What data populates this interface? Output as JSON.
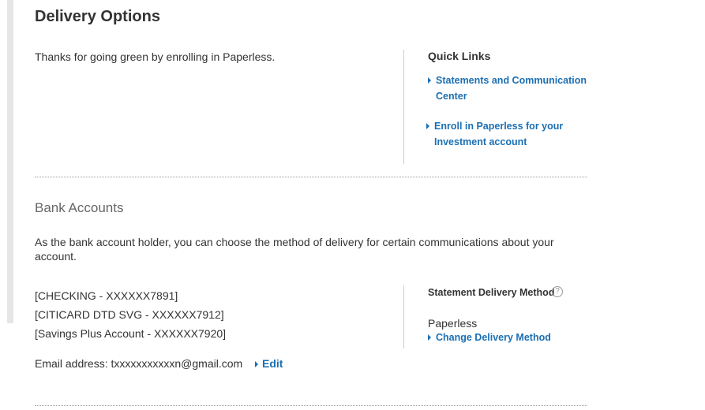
{
  "page_title": "Delivery Options",
  "intro_text": "Thanks for going green by enrolling in Paperless.",
  "quick_links": {
    "heading": "Quick Links",
    "items": [
      {
        "label_line1": "Statements and Communication",
        "label_line2": "Center"
      },
      {
        "label_line1": "Enroll in Paperless for your",
        "label_line2": "Investment account"
      }
    ]
  },
  "bank_accounts": {
    "title": "Bank Accounts",
    "description": "As the bank account holder, you can choose the method of delivery for certain communications about your account.",
    "accounts": [
      "[CHECKING - XXXXXX7891]",
      "[CITICARD DTD SVG - XXXXXX7912]",
      "[Savings Plus Account - XXXXXX7920]"
    ],
    "email_label": "Email address:",
    "email_value": "txxxxxxxxxxxn@gmail.com",
    "edit_label": "Edit"
  },
  "statement_delivery": {
    "heading": "Statement Delivery Method",
    "help_icon": "question-circle-icon",
    "help_glyph": "?",
    "value": "Paperless",
    "change_label": "Change Delivery Method"
  },
  "colors": {
    "link": "#1b6fb3",
    "text": "#333333",
    "section_title": "#666666"
  }
}
